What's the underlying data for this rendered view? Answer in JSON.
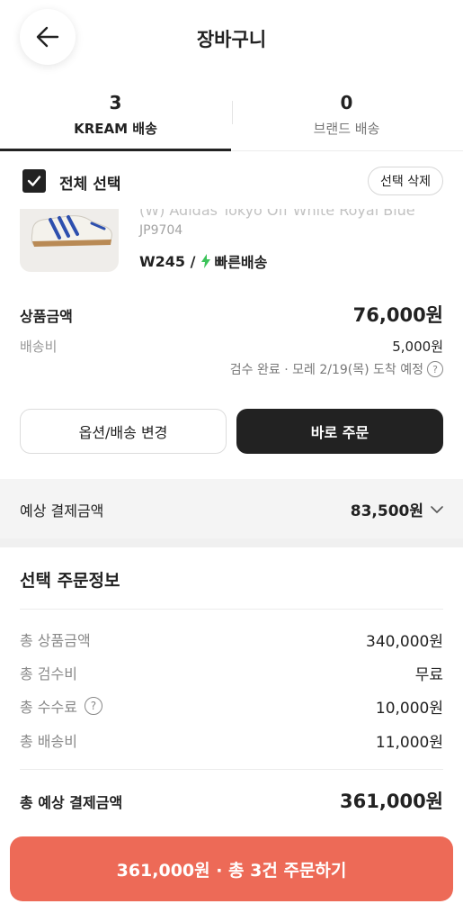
{
  "header": {
    "title": "장바구니"
  },
  "tabs": [
    {
      "count": "3",
      "label": "KREAM 배송"
    },
    {
      "count": "0",
      "label": "브랜드 배송"
    }
  ],
  "select_all": {
    "label": "전체 선택",
    "checked": true,
    "delete_label": "선택 삭제"
  },
  "product": {
    "name": "(W) Adidas Tokyo Off White Royal Blue",
    "code": "JP9704",
    "size": "W245 /",
    "shipping": "빠른배송"
  },
  "pricing": {
    "item_label": "상품금액",
    "item_value": "76,000원",
    "shipping_label": "배송비",
    "shipping_value": "5,000원",
    "arrival_note": "검수 완료 · 모레 2/19(목) 도착 예정"
  },
  "buttons": {
    "change_option": "옵션/배송 변경",
    "order_now": "바로 주문"
  },
  "estimate": {
    "label": "예상 결제금액",
    "value": "83,500원"
  },
  "order_info": {
    "title": "선택 주문정보",
    "rows": [
      {
        "label": "총 상품금액",
        "value": "340,000원"
      },
      {
        "label": "총 검수비",
        "value": "무료"
      },
      {
        "label": "총 수수료",
        "value": "10,000원"
      },
      {
        "label": "총 배송비",
        "value": "11,000원"
      }
    ],
    "total_label": "총 예상 결제금액",
    "total_value": "361,000원"
  },
  "cta": {
    "label": "361,000원 · 총 3건 주문하기"
  },
  "colors": {
    "accent": "#ed6a57",
    "dark": "#222222",
    "bolt": "#3cc35a"
  },
  "icons": {
    "back": "arrow-left-icon",
    "check": "check-icon",
    "help": "question-circle-icon",
    "expand": "chevron-down-icon",
    "fast": "lightning-icon"
  }
}
